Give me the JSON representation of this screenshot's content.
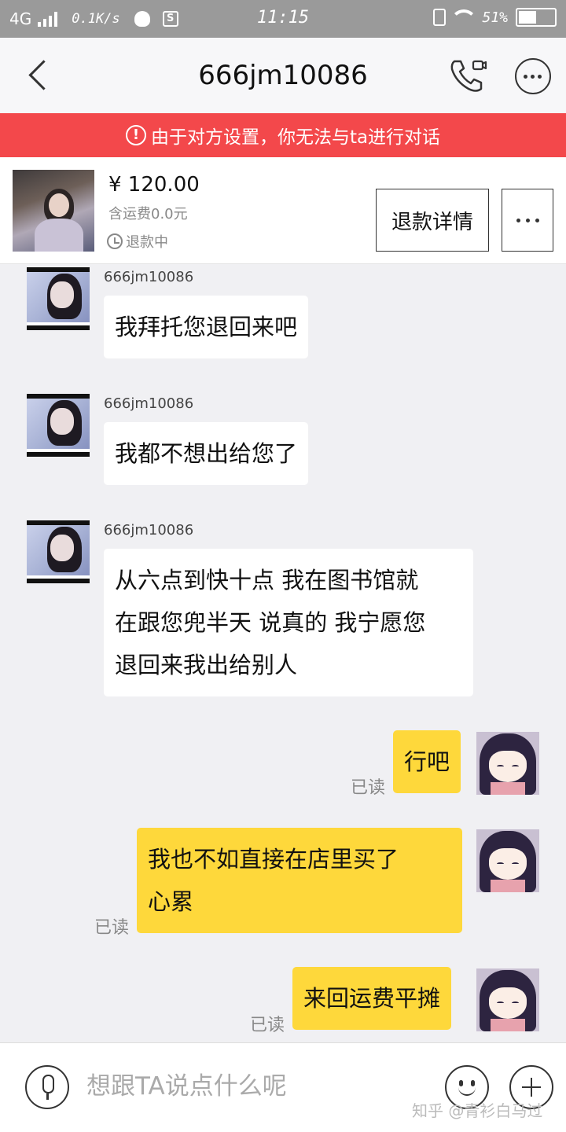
{
  "status_bar": {
    "network": "4G",
    "speed": "0.1K/s",
    "time": "11:15",
    "battery": "51%",
    "battery_level": 0.51
  },
  "header": {
    "title": "666jm10086"
  },
  "warning": {
    "text": "由于对方设置，你无法与ta进行对话"
  },
  "order": {
    "price": "¥ 120.00",
    "shipping": "含运费0.0元",
    "status": "退款中",
    "refund_button": "退款详情"
  },
  "messages": [
    {
      "side": "left",
      "sender": "666jm10086",
      "text": "我拜托您退回来吧"
    },
    {
      "side": "left",
      "sender": "666jm10086",
      "text": "我都不想出给您了"
    },
    {
      "side": "left",
      "sender": "666jm10086",
      "lines": [
        "从六点到快十点 我在图书馆就",
        "在跟您兜半天 说真的 我宁愿您",
        "退回来我出给别人"
      ]
    },
    {
      "side": "right",
      "text": "行吧",
      "read": "已读"
    },
    {
      "side": "right",
      "lines": [
        "我也不如直接在店里买了",
        "心累"
      ],
      "read": "已读"
    },
    {
      "side": "right",
      "text": "来回运费平摊",
      "read": "已读"
    }
  ],
  "input": {
    "placeholder": "想跟TA说点什么呢"
  },
  "watermark": "知乎 @青衫白马过",
  "colors": {
    "warning_bg": "#f3484b",
    "outgoing_bubble": "#fed83b",
    "incoming_bubble": "#ffffff",
    "chat_bg": "#f0f0f3"
  }
}
